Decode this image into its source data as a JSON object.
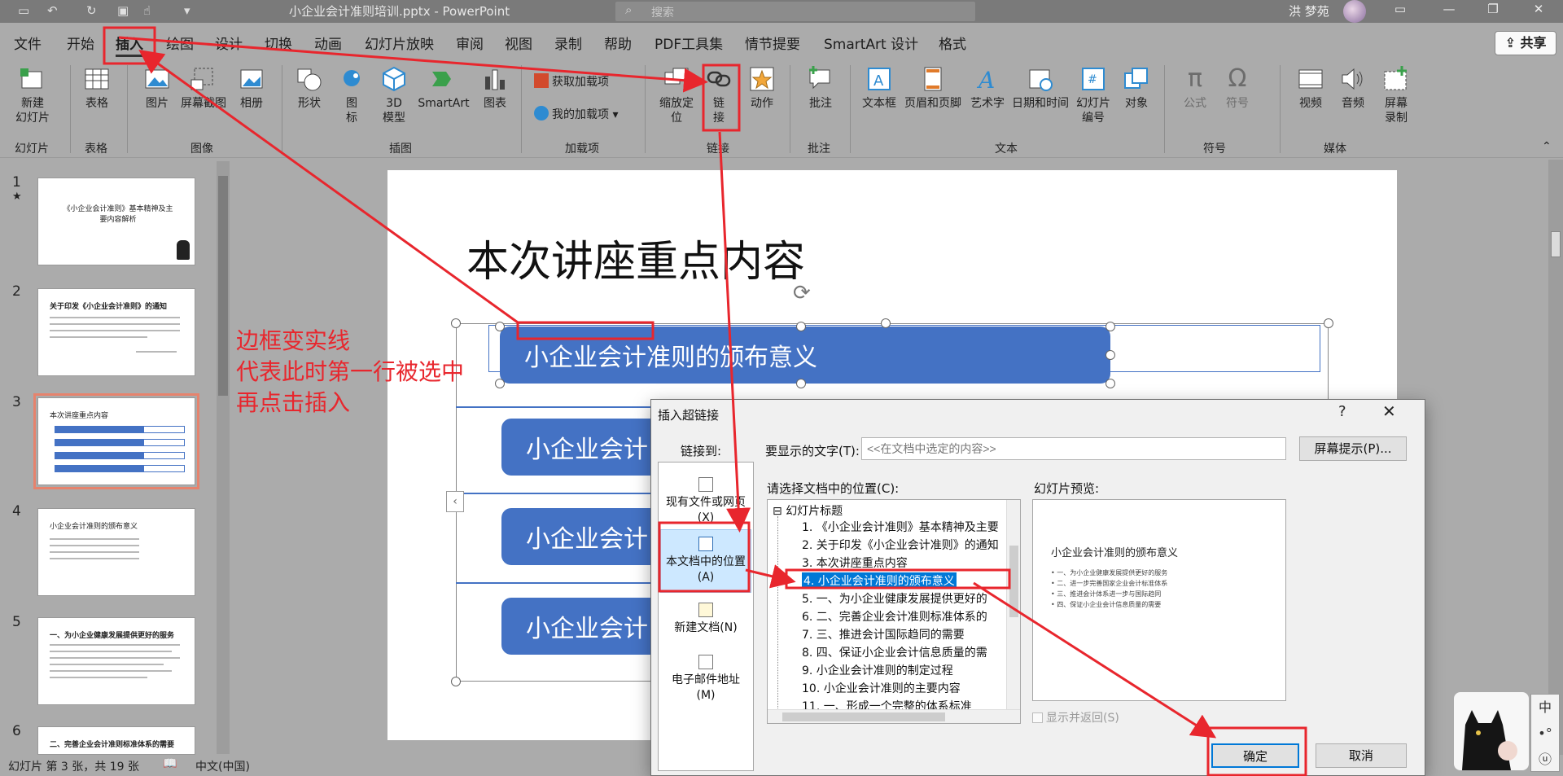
{
  "titlebar": {
    "doc_title": "小企业会计准则培训.pptx - PowerPoint",
    "search_placeholder": "搜索",
    "user_name": "洪 梦苑",
    "quick_access_icons": [
      "save-icon",
      "undo-icon",
      "redo-icon",
      "present-icon",
      "touch-icon",
      "customize-icon"
    ]
  },
  "menu": {
    "tabs": [
      "文件",
      "开始",
      "插入",
      "绘图",
      "设计",
      "切换",
      "动画",
      "幻灯片放映",
      "审阅",
      "视图",
      "录制",
      "帮助",
      "PDF工具集",
      "情节提要",
      "SmartArt 设计",
      "格式"
    ],
    "active_tab": "插入",
    "share": "共享"
  },
  "ribbon": {
    "new_slide": "新建\n幻灯片",
    "table": "表格",
    "picture": "图片",
    "screenshot": "屏幕截图",
    "album": "相册",
    "shapes": "形状",
    "icons": "图\n标",
    "model3d": "3D\n模型",
    "smartart": "SmartArt",
    "chart": "图表",
    "get_addins": "获取加载项",
    "my_addins": "我的加载项",
    "zoom": "缩放定\n位",
    "link": "链\n接",
    "action": "动作",
    "comment": "批注",
    "textbox": "文本框",
    "header_footer": "页眉和页脚",
    "wordart": "艺术字",
    "datetime": "日期和时间",
    "slide_number": "幻灯片\n编号",
    "object": "对象",
    "equation": "公式",
    "symbol": "符号",
    "video": "视频",
    "audio": "音频",
    "screen_record": "屏幕\n录制",
    "groups": {
      "slides": "幻灯片",
      "tables": "表格",
      "images": "图像",
      "illustrations": "插图",
      "addins": "加载项",
      "links": "链接",
      "comments": "批注",
      "text": "文本",
      "symbols": "符号",
      "media": "媒体"
    }
  },
  "thumbnails": {
    "numbers": [
      "1",
      "2",
      "3",
      "4",
      "5",
      "6"
    ],
    "slide1_title": "《小企业会计准则》基本精神及主要内容解析",
    "slide2_title": "关于印发《小企业会计准则》的通知",
    "slide3_title": "本次讲座重点内容",
    "slide4_title": "小企业会计准则的颁布意义",
    "slide5_title": "一、为小企业健康发展提供更好的服务",
    "slide6_title": "二、完善企业会计准则标准体系的需要"
  },
  "slide": {
    "title": "本次讲座重点内容",
    "box1": "小企业会计准则的颁布意义",
    "box2": "小企业会计",
    "box3": "小企业会计",
    "box4": "小企业会计"
  },
  "annotation": {
    "line1": "边框变实线",
    "line2": "代表此时第一行被选中",
    "line3": "再点击插入"
  },
  "status": {
    "slide_info": "幻灯片 第 3 张，共 19 张",
    "language": "中文(中国)"
  },
  "dialog": {
    "title": "插入超链接",
    "help": "?",
    "close": "✕",
    "link_to": "链接到:",
    "display_text_label": "要显示的文字(T):",
    "display_text_value": "<<在文档中选定的内容>>",
    "screentip": "屏幕提示(P)...",
    "place_label": "请选择文档中的位置(C):",
    "preview_label": "幻灯片预览:",
    "link_items": [
      "现有文件或网页\n(X)",
      "本文档中的位置\n(A)",
      "新建文档(N)",
      "电子邮件地址\n(M)"
    ],
    "tree_root": "幻灯片标题",
    "tree_items": [
      "1. 《小企业会计准则》基本精神及主要",
      "2. 关于印发《小企业会计准则》的通知",
      "3. 本次讲座重点内容",
      "4. 小企业会计准则的颁布意义",
      "5. 一、为小企业健康发展提供更好的",
      "6. 二、完善企业会计准则标准体系的",
      "7. 三、推进会计国际趋同的需要",
      "8. 四、保证小企业会计信息质量的需",
      "9. 小企业会计准则的制定过程",
      "10. 小企业会计准则的主要内容",
      "11. 一、形成一个完整的体系标准"
    ],
    "selected_index": 3,
    "preview_title": "小企业会计准则的颁布意义",
    "preview_bullets": [
      "• 一、为小企业健康发展提供更好的服务",
      "• 二、进一步完善国家企业会计标准体系",
      "• 三、推进会计体系进一步与国际趋同",
      "• 四、保证小企业会计信息质量的需要"
    ],
    "show_return": "显示并返回(S)",
    "ok": "确定",
    "cancel": "取消"
  },
  "ime": [
    "中",
    "•°",
    "ⓤ"
  ],
  "colors": {
    "annotation_red": "#e8262d",
    "smartart_blue": "#4472c4",
    "selection_blue": "#0078d7"
  }
}
